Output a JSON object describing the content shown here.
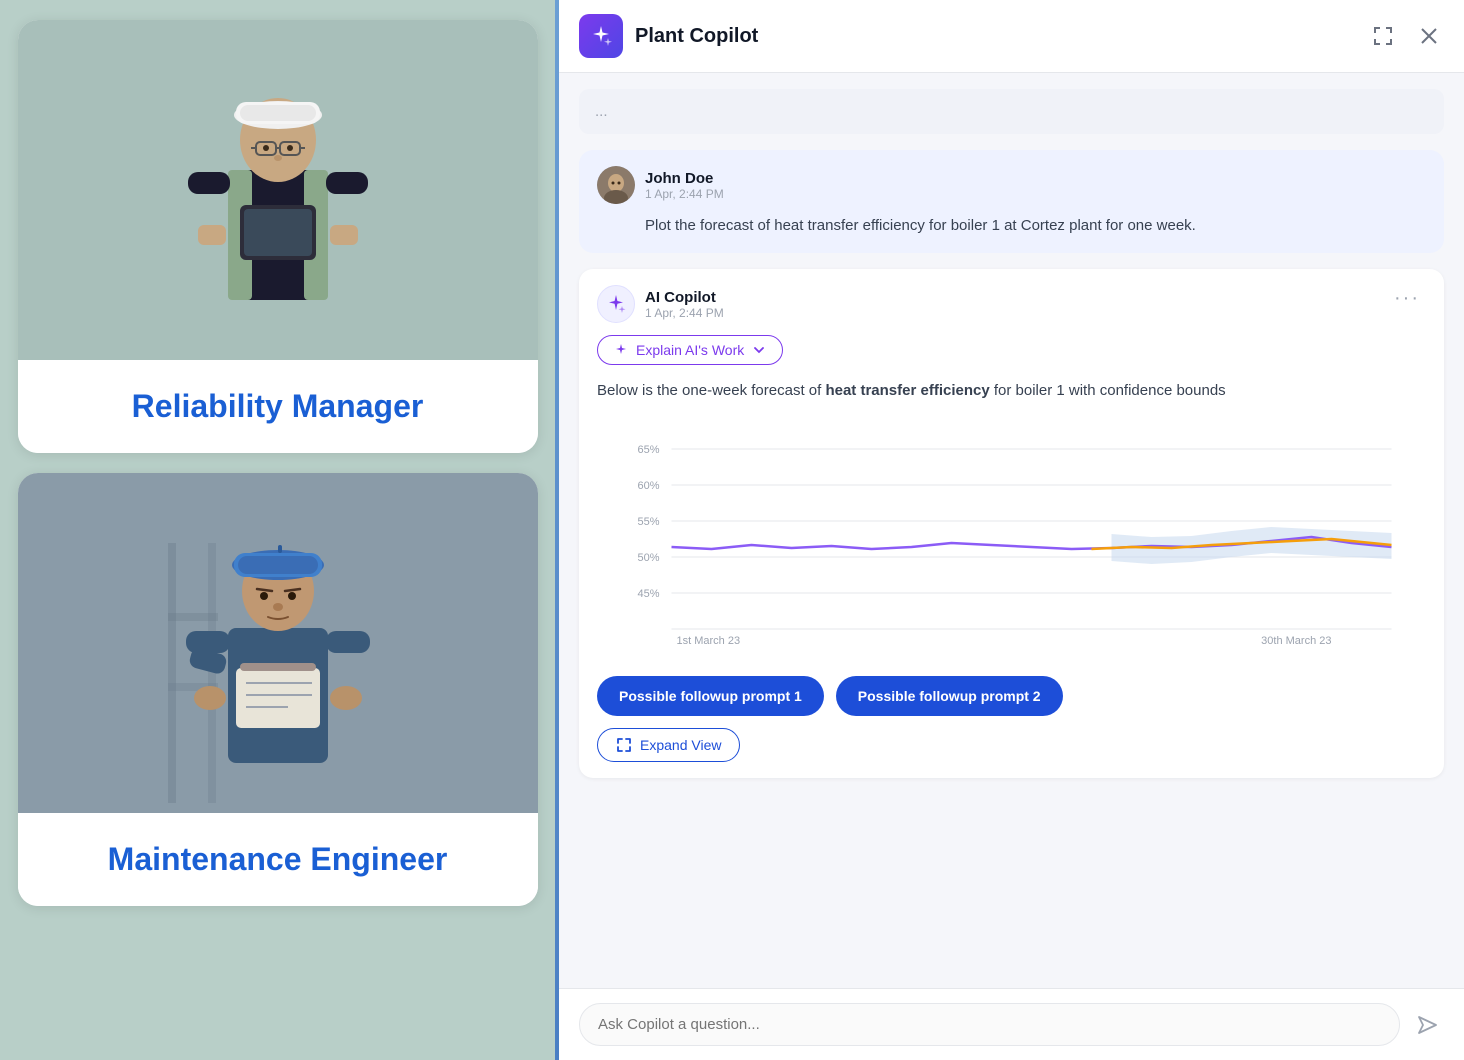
{
  "left": {
    "personas": [
      {
        "id": "reliability-manager",
        "label": "Reliability Manager",
        "imageType": "reliability"
      },
      {
        "id": "maintenance-engineer",
        "label": "Maintenance Engineer",
        "imageType": "maintenance"
      }
    ]
  },
  "chat": {
    "header": {
      "title": "Plant Copilot",
      "expand_label": "expand",
      "close_label": "close"
    },
    "messages": [
      {
        "type": "truncated",
        "text": "..."
      },
      {
        "type": "user",
        "sender": "John Doe",
        "time": "1 Apr, 2:44 PM",
        "text": "Plot the forecast of heat transfer efficiency for boiler 1 at Cortez plant for one week."
      },
      {
        "type": "ai",
        "sender": "AI Copilot",
        "time": "1 Apr, 2:44 PM",
        "explain_label": "Explain AI's Work",
        "body_text_before": "Below is the one-week forecast of ",
        "body_text_bold": "heat transfer efficiency",
        "body_text_after": " for boiler 1 with confidence bounds",
        "chart": {
          "y_labels": [
            "65%",
            "60%",
            "55%",
            "50%",
            "45%"
          ],
          "x_labels": [
            "1st March 23",
            "30th March 23"
          ],
          "purple_line": [
            52,
            51,
            52.5,
            51.5,
            52,
            51,
            52,
            53,
            52.5,
            53,
            52,
            51.5,
            52.5,
            51,
            52.5,
            53.5,
            54,
            52.5,
            51.5,
            52
          ],
          "orange_line": [
            52,
            51.5,
            52,
            51.8,
            52.2,
            51.5,
            52.5,
            53,
            52.8,
            53.2,
            52.2,
            51.8,
            52.5,
            51.5,
            52.5,
            53.2,
            53.5,
            52.8,
            51.8,
            52.2
          ],
          "confidence_band_start": 12,
          "y_min": 44,
          "y_max": 67
        },
        "followup1": "Possible followup prompt 1",
        "followup2": "Possible followup prompt 2",
        "expand_label": "Expand View"
      }
    ],
    "input_placeholder": "Ask Copilot a question..."
  }
}
